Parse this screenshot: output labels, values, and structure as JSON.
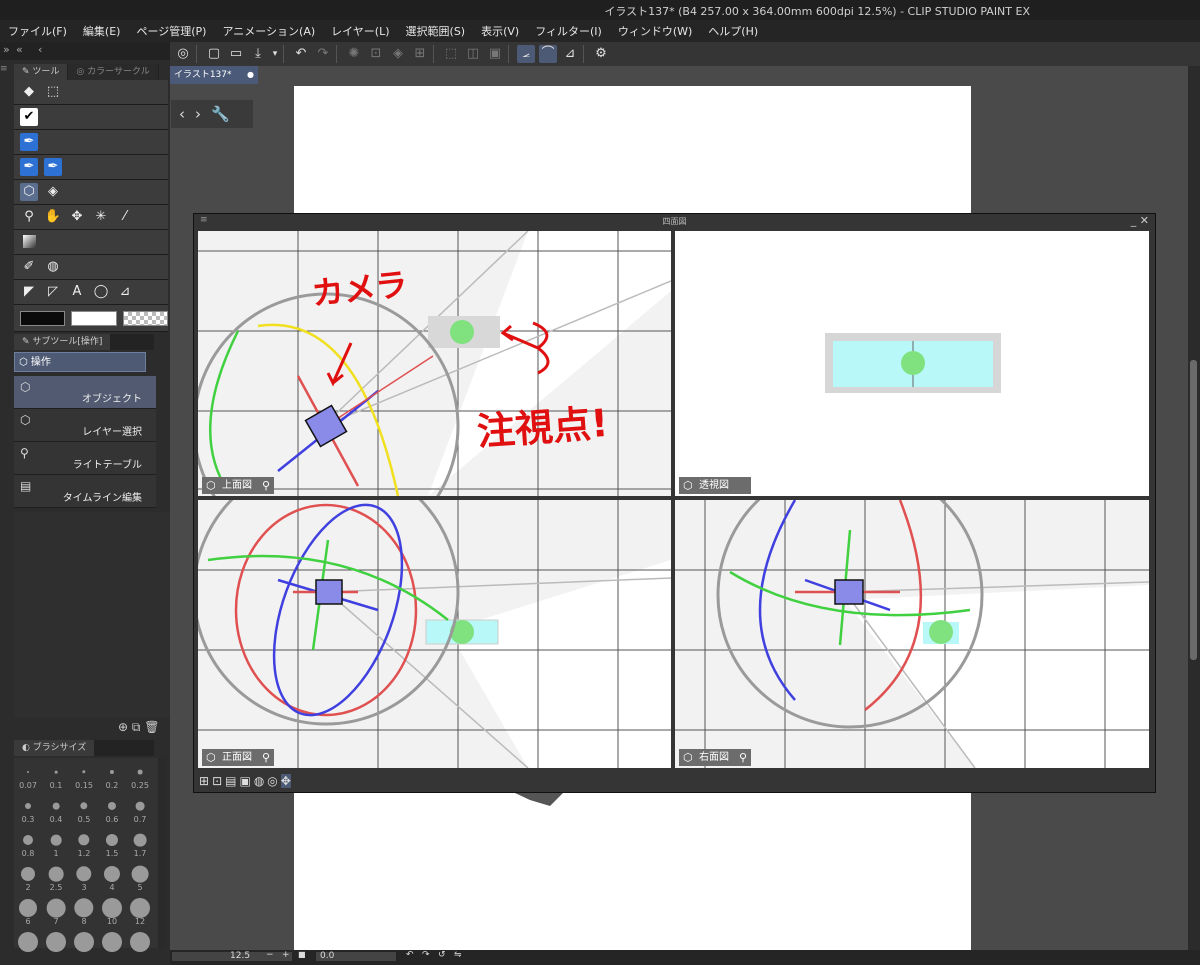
{
  "window": {
    "title": "イラスト137* (B4 257.00 x 364.00mm 600dpi 12.5%)  - CLIP STUDIO PAINT EX"
  },
  "menu": [
    "ファイル(F)",
    "編集(E)",
    "ページ管理(P)",
    "アニメーション(A)",
    "レイヤー(L)",
    "選択範囲(S)",
    "表示(V)",
    "フィルター(I)",
    "ウィンドウ(W)",
    "ヘルプ(H)"
  ],
  "tool_panel": {
    "tabs": [
      "ツール",
      "カラーサークル"
    ]
  },
  "sub_tool_panel": {
    "tab": "サブツール[操作]",
    "group": "操作",
    "items": [
      "オブジェクト",
      "レイヤー選択",
      "ライトテーブル",
      "タイムライン編集"
    ]
  },
  "brush_size": {
    "tab": "ブラシサイズ",
    "sizes": [
      "0.07",
      "0.1",
      "0.15",
      "0.2",
      "0.25",
      "0.3",
      "0.4",
      "0.5",
      "0.6",
      "0.7",
      "0.8",
      "1",
      "1.2",
      "1.5",
      "1.7",
      "2",
      "2.5",
      "3",
      "4",
      "5",
      "6",
      "7",
      "8",
      "10",
      "12",
      "",
      "",
      "",
      "",
      ""
    ]
  },
  "document": {
    "tab": "イラスト137*"
  },
  "four_view": {
    "title": "四面図",
    "views": {
      "top": "上面図",
      "perspective": "透視図",
      "front": "正面図",
      "right": "右面図"
    }
  },
  "annotations": {
    "camera": "カメラ",
    "vanishing_point": "注視点!"
  },
  "statusbar": {
    "zoom": "12.5",
    "rotation": "0.0"
  },
  "colors": {
    "main": "#0b0b0b",
    "sub": "#ffffff",
    "accent": "#2e71d4",
    "annotation": "#e01010"
  }
}
